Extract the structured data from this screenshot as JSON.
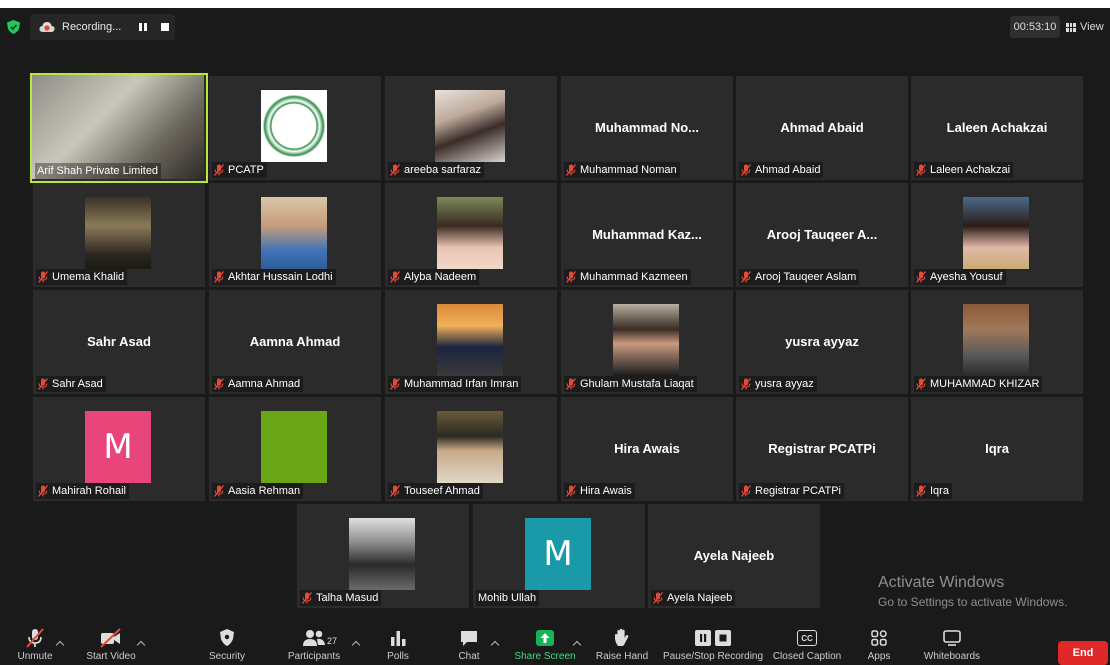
{
  "recording": {
    "label": "Recording...",
    "timer": "00:53:10",
    "view_label": "View"
  },
  "tiles": [
    {
      "label": "Arif Shah Private Limited",
      "big": "",
      "muted": false
    },
    {
      "label": "PCATP",
      "big": "",
      "muted": true
    },
    {
      "label": "areeba sarfaraz",
      "big": "",
      "muted": true
    },
    {
      "label": "Muhammad Noman",
      "big": "Muhammad  No...",
      "muted": true
    },
    {
      "label": "Ahmad Abaid",
      "big": "Ahmad Abaid",
      "muted": true
    },
    {
      "label": "Laleen Achakzai",
      "big": "Laleen Achakzai",
      "muted": true
    },
    {
      "label": "Umema Khalid",
      "big": "",
      "muted": true
    },
    {
      "label": "Akhtar Hussain Lodhi",
      "big": "",
      "muted": true
    },
    {
      "label": "Alyba Nadeem",
      "big": "",
      "muted": true
    },
    {
      "label": "Muhammad Kazmeen",
      "big": "Muhammad  Kaz...",
      "muted": true
    },
    {
      "label": "Arooj Tauqeer Aslam",
      "big": "Arooj Tauqeer A...",
      "muted": true
    },
    {
      "label": "Ayesha Yousuf",
      "big": "",
      "muted": true
    },
    {
      "label": "Sahr Asad",
      "big": "Sahr Asad",
      "muted": true
    },
    {
      "label": "Aamna Ahmad",
      "big": "Aamna Ahmad",
      "muted": true
    },
    {
      "label": "Muhammad Irfan Imran",
      "big": "",
      "muted": true
    },
    {
      "label": "Ghulam Mustafa Liaqat",
      "big": "",
      "muted": true
    },
    {
      "label": "yusra ayyaz",
      "big": "yusra ayyaz",
      "muted": true
    },
    {
      "label": "MUHAMMAD KHIZAR",
      "big": "",
      "muted": true
    },
    {
      "label": "Mahirah Rohail",
      "big": "",
      "muted": true,
      "avatar_letter": "M",
      "avatar_color": "#e8457a"
    },
    {
      "label": "Aasia Rehman",
      "big": "",
      "muted": true,
      "avatar_color": "#6aa615"
    },
    {
      "label": "Touseef Ahmad",
      "big": "",
      "muted": true
    },
    {
      "label": "Hira Awais",
      "big": "Hira Awais",
      "muted": true
    },
    {
      "label": "Registrar PCATPi",
      "big": "Registrar PCATPi",
      "muted": true
    },
    {
      "label": "Iqra",
      "big": "Iqra",
      "muted": true
    },
    {
      "label": "Talha Masud",
      "big": "",
      "muted": true
    },
    {
      "label": "Mohib Ullah",
      "big": "",
      "muted": false,
      "avatar_letter": "M",
      "avatar_color": "#1a9aa8"
    },
    {
      "label": "Ayela Najeeb",
      "big": "Ayela Najeeb",
      "muted": true
    }
  ],
  "watermark": {
    "line1": "Activate Windows",
    "line2": "Go to Settings to activate Windows."
  },
  "toolbar": {
    "unmute": "Unmute",
    "start_video": "Start Video",
    "security": "Security",
    "participants": "Participants",
    "participants_count": "27",
    "polls": "Polls",
    "chat": "Chat",
    "share_screen": "Share Screen",
    "raise_hand": "Raise Hand",
    "pause_recording": "Pause/Stop Recording",
    "closed_caption": "Closed Caption",
    "cc_icon_text": "CC",
    "apps": "Apps",
    "whiteboards": "Whiteboards",
    "end": "End"
  },
  "colors": {
    "accent_green": "#b8e83a",
    "share_green": "#18b257",
    "end_red": "#e02828",
    "muted_red": "#e84a3a"
  }
}
